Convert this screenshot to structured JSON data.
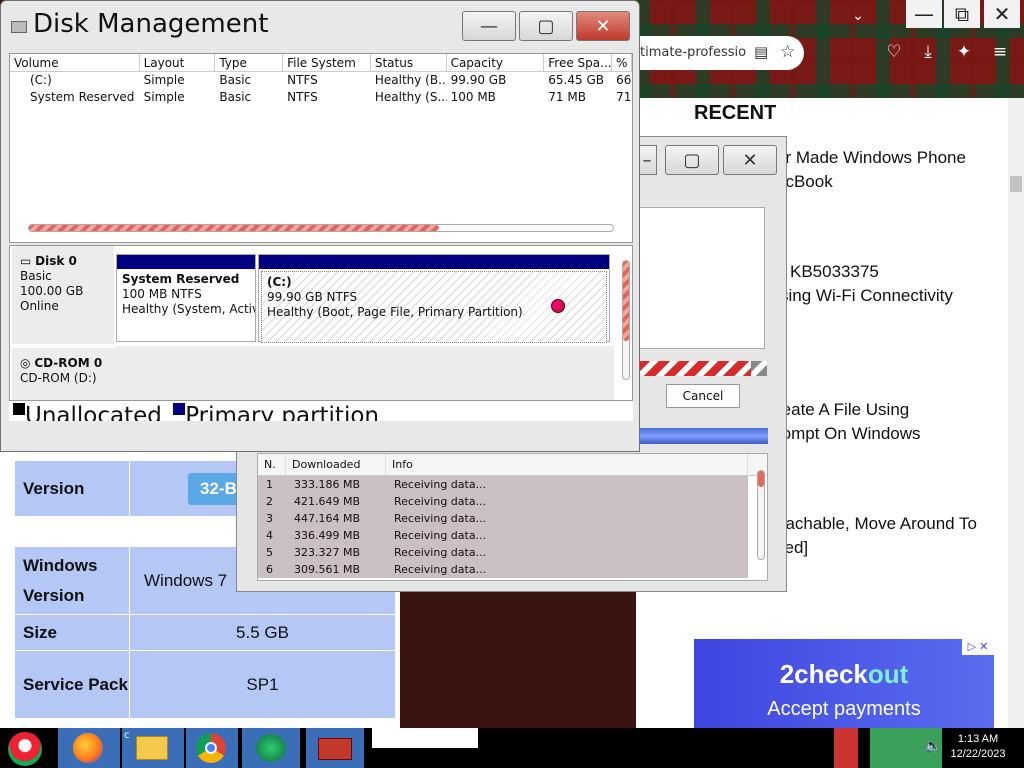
{
  "browser": {
    "controls": [
      "—",
      "⧉",
      "✕"
    ],
    "url_fragment": "timate-professio",
    "recent_heading": "RECENT",
    "articles": [
      [
        "er Made Windows Phone",
        "acBook"
      ],
      [
        "KB5033375",
        "sing Wi-Fi Connectivity"
      ],
      [
        "reate A File Using",
        "rompt On Windows"
      ],
      [
        "eachable, Move Around To",
        "ked]"
      ]
    ],
    "ad": {
      "brand_a": "2check",
      "brand_b": "out",
      "tagline": "Accept payments",
      "badge": "▷ ✕"
    },
    "table": [
      {
        "key": "Version",
        "value": "32-B"
      },
      {
        "key": "Windows Version",
        "value": "Windows 7"
      },
      {
        "key": "Size",
        "value": "5.5 GB"
      },
      {
        "key": "Service Pack",
        "value": "SP1"
      }
    ]
  },
  "disk_management": {
    "title": "Disk Management",
    "columns": [
      "Volume",
      "Layout",
      "Type",
      "File System",
      "Status",
      "Capacity",
      "Free Spa...",
      "% F"
    ],
    "rows": [
      [
        "(C:)",
        "Simple",
        "Basic",
        "NTFS",
        "Healthy (B...",
        "99.90 GB",
        "65.45 GB",
        "66"
      ],
      [
        "System Reserved",
        "Simple",
        "Basic",
        "NTFS",
        "Healthy (S...",
        "100 MB",
        "71 MB",
        "71"
      ]
    ],
    "disk0": {
      "name": "Disk 0",
      "type": "Basic",
      "size": "100.00 GB",
      "state": "Online"
    },
    "partitions": [
      {
        "name": "System Reserved",
        "size": "100 MB NTFS",
        "status": "Healthy (System, Active,"
      },
      {
        "name": "(C:)",
        "size": "99.90 GB NTFS",
        "status": "Healthy (Boot, Page File, Primary Partition)"
      }
    ],
    "cdrom": {
      "name": "CD-ROM 0",
      "sub": "CD-ROM (D:)"
    },
    "legend": [
      "Unallocated",
      "Primary partition"
    ]
  },
  "progress": {
    "cancel_label": "Cancel",
    "columns": [
      "N.",
      "Downloaded",
      "Info"
    ],
    "rows": [
      [
        "1",
        "333.186  MB",
        "Receiving data..."
      ],
      [
        "2",
        "421.649  MB",
        "Receiving data..."
      ],
      [
        "3",
        "447.164  MB",
        "Receiving data..."
      ],
      [
        "4",
        "336.499  MB",
        "Receiving data..."
      ],
      [
        "5",
        "323.327  MB",
        "Receiving data..."
      ],
      [
        "6",
        "309.561  MB",
        "Receiving data..."
      ]
    ]
  },
  "taskbar": {
    "time": "1:13 AM",
    "date": "12/22/2023",
    "extra_label": "c"
  }
}
